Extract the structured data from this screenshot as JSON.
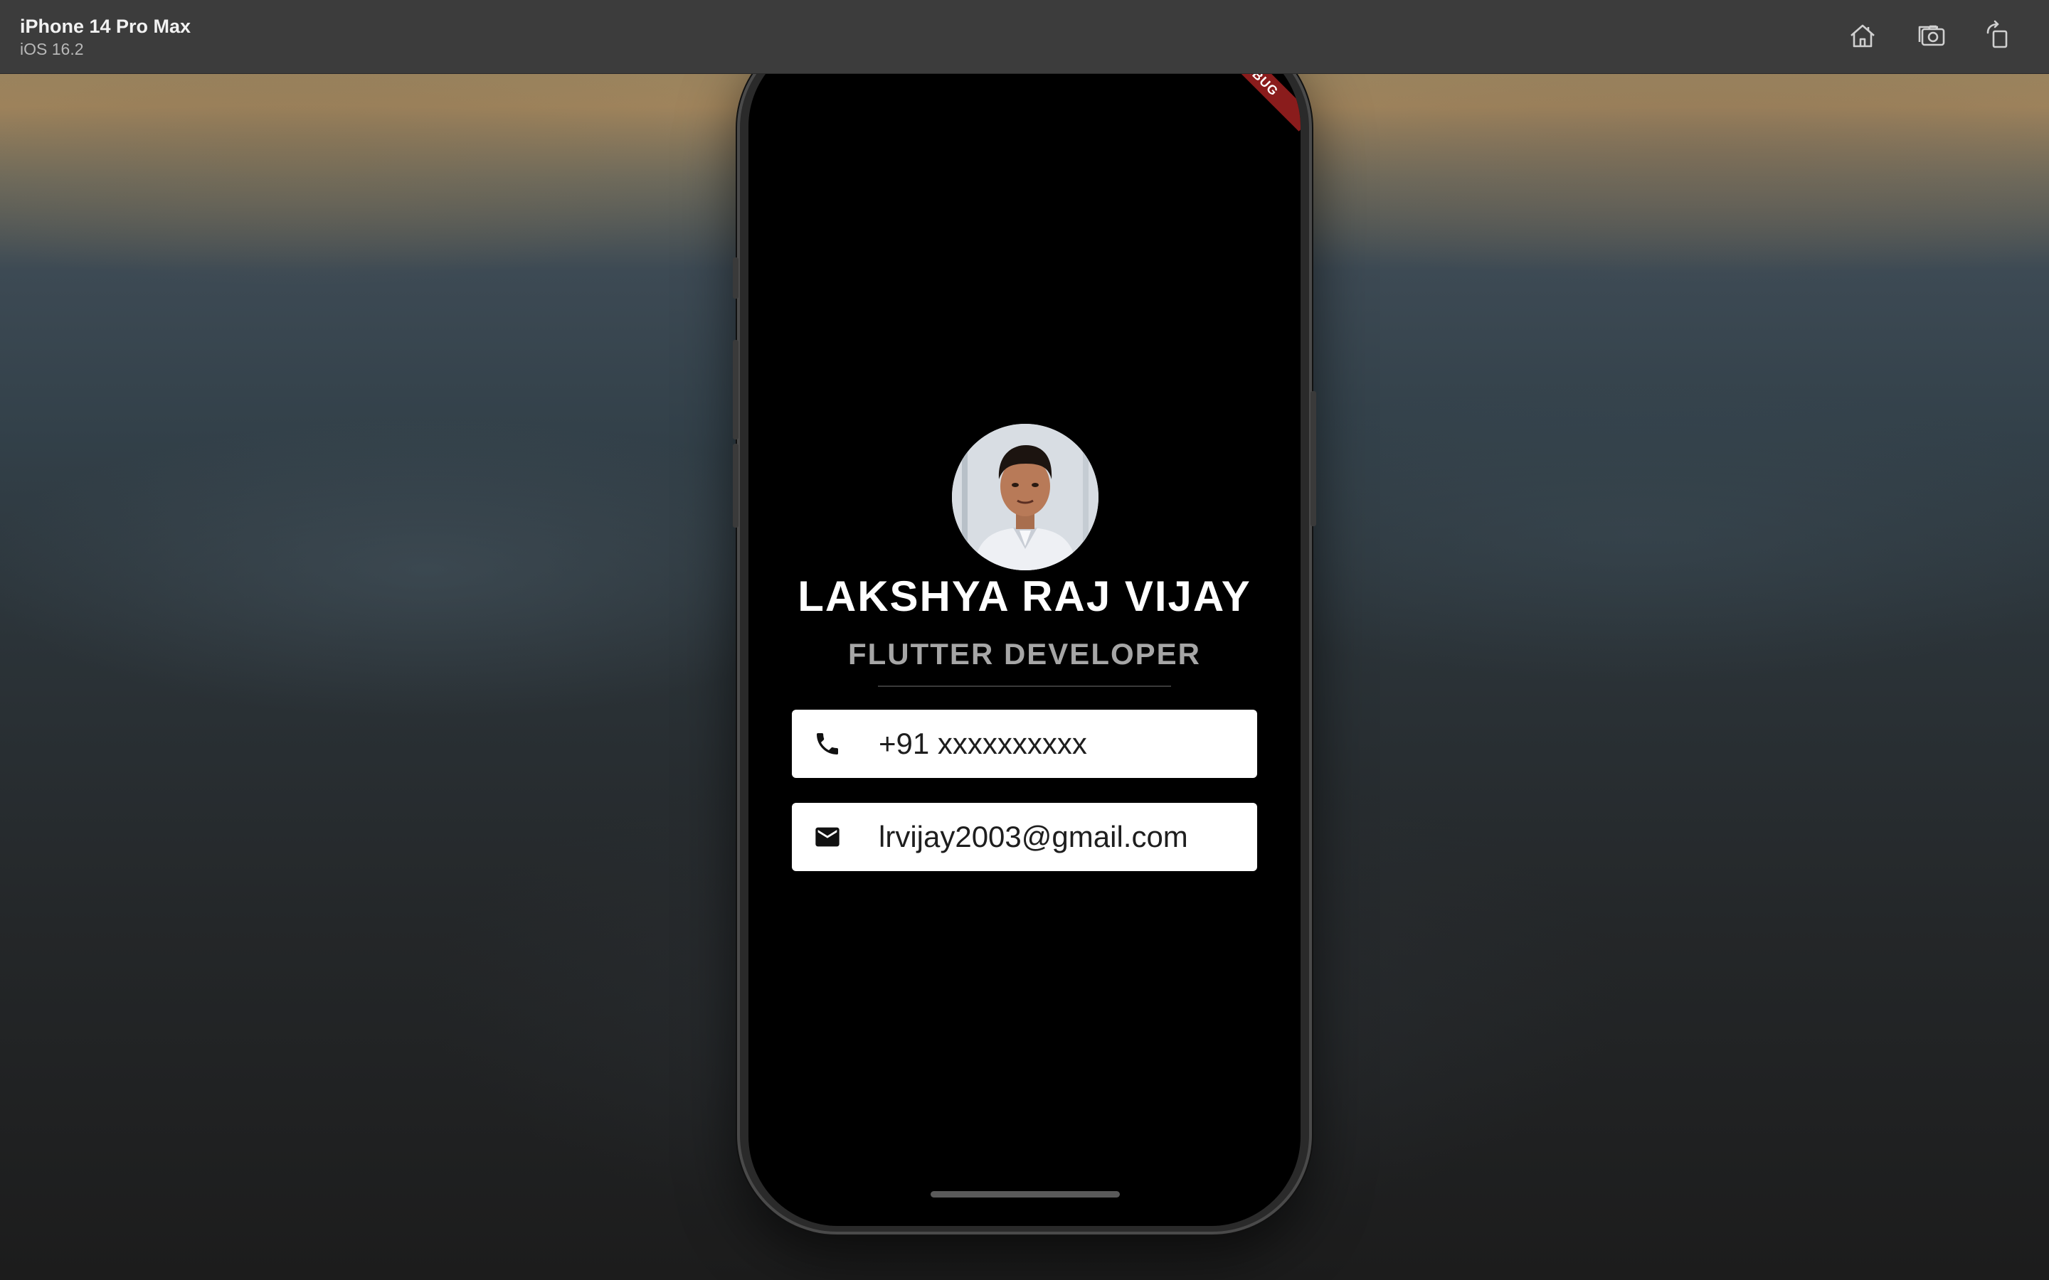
{
  "toolbar": {
    "device_name": "iPhone 14 Pro Max",
    "os_version": "iOS 16.2",
    "buttons": [
      {
        "icon": "home-icon"
      },
      {
        "icon": "camera-icon"
      },
      {
        "icon": "rotate-icon"
      }
    ]
  },
  "app": {
    "debug_banner": "DEBUG",
    "name": "LAKSHYA RAJ VIJAY",
    "title": "FLUTTER DEVELOPER",
    "contacts": [
      {
        "icon": "phone-icon",
        "value": "+91 xxxxxxxxxx"
      },
      {
        "icon": "email-icon",
        "value": "lrvijay2003@gmail.com"
      }
    ]
  },
  "colors": {
    "screen_bg": "#000000",
    "card_bg": "#ffffff",
    "debug_banner": "#8a1c1c",
    "title_text": "#a6a6a6"
  }
}
